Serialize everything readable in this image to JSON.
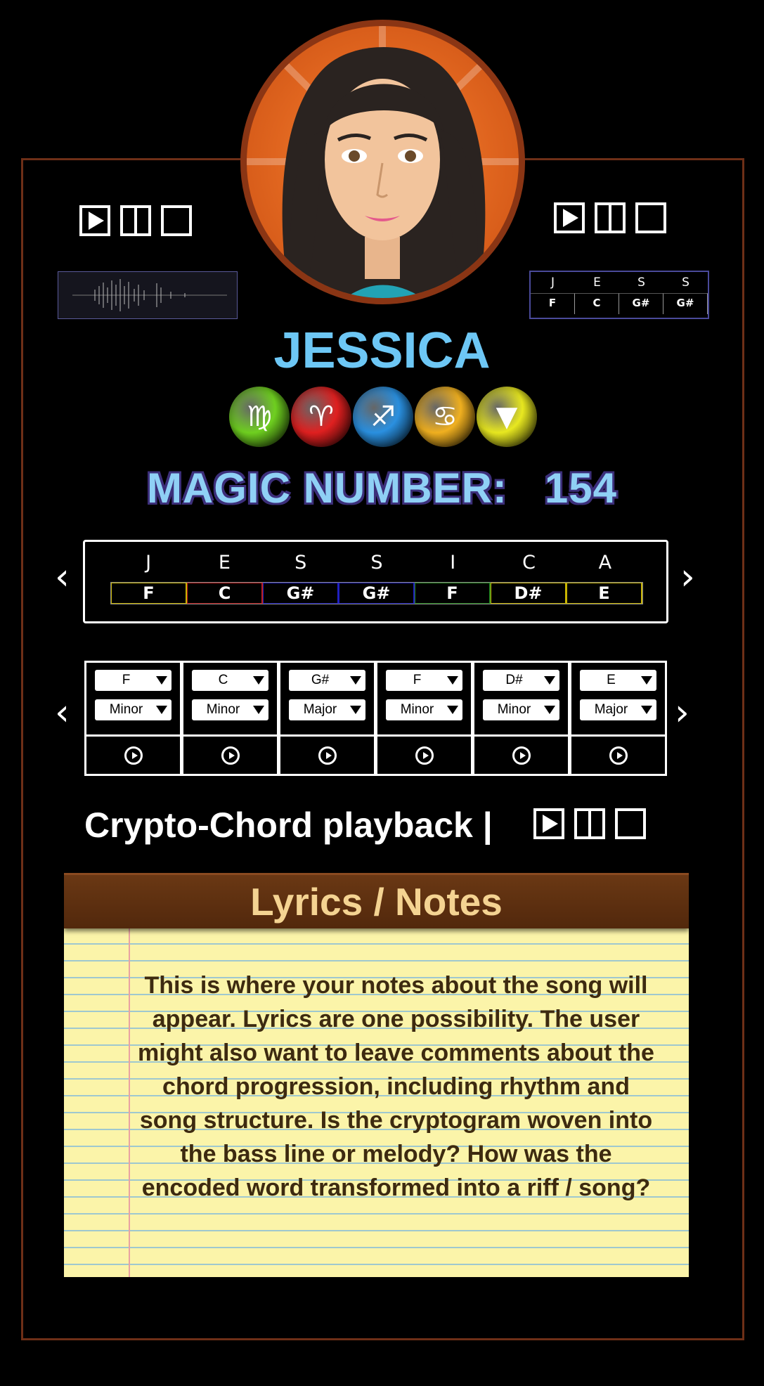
{
  "profile": {
    "name": "JESSICA",
    "magic_number_label": "MAGIC NUMBER:",
    "magic_number": "154"
  },
  "zodiac_gems": [
    {
      "icon": "virgo-gem-icon",
      "glyph": "♍",
      "color": "#6fd020"
    },
    {
      "icon": "aries-gem-icon",
      "glyph": "♈",
      "color": "#e02020"
    },
    {
      "icon": "sagittarius-gem-icon",
      "glyph": "♐",
      "color": "#2a90e0"
    },
    {
      "icon": "cancer-gem-icon",
      "glyph": "♋",
      "color": "#f0b020"
    },
    {
      "icon": "triangle-gem-icon",
      "glyph": "▼",
      "color": "#e8e820"
    }
  ],
  "mini_crypto": {
    "letters": [
      "J",
      "E",
      "S",
      "S"
    ],
    "notes": [
      "F",
      "C",
      "G#",
      "G#"
    ]
  },
  "crypto": {
    "letters": [
      "J",
      "E",
      "S",
      "S",
      "I",
      "C",
      "A"
    ],
    "notes": [
      "F",
      "C",
      "G#",
      "G#",
      "F",
      "D#",
      "E"
    ],
    "note_colors": [
      "#c8b400",
      "#c02020",
      "#2020c0",
      "#2020c0",
      "#2a8a20",
      "#c8b400",
      "#c8b400"
    ]
  },
  "chords": [
    {
      "root": "F",
      "quality": "Minor"
    },
    {
      "root": "C",
      "quality": "Minor"
    },
    {
      "root": "G#",
      "quality": "Major"
    },
    {
      "root": "F",
      "quality": "Minor"
    },
    {
      "root": "D#",
      "quality": "Minor"
    },
    {
      "root": "E",
      "quality": "Major"
    }
  ],
  "playback": {
    "label": "Crypto-Chord playback |"
  },
  "notes_panel": {
    "title": "Lyrics / Notes",
    "body": "This is where your notes about the song will appear. Lyrics are one possibility. The user might also want to leave comments about the chord progression, including rhythm and song structure. Is the cryptogram woven into the bass line or melody? How was the encoded word transformed into a riff / song?"
  },
  "colors": {
    "name": "#6dc7f5",
    "frame": "#6e2f17",
    "notepad_header": "#52280c",
    "notepad_title": "#f4d392",
    "notepad_paper": "#fbf4a9"
  }
}
